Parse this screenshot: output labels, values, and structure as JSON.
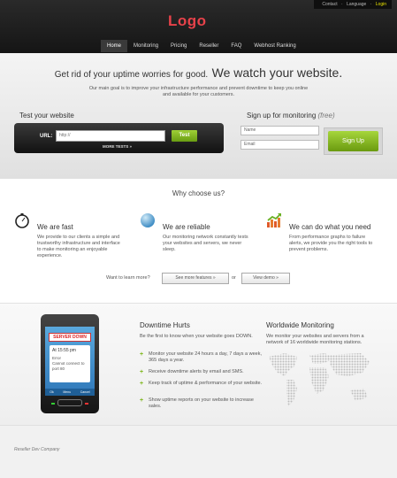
{
  "topbar": {
    "contact": "Contact",
    "sep1": "·",
    "language": "Language",
    "sep2": "·",
    "login": "Login"
  },
  "logo": "Logo",
  "nav": [
    "Home",
    "Monitoring",
    "Pricing",
    "Reseller",
    "FAQ",
    "Webhost Ranking"
  ],
  "hero": {
    "tagline_small": "Get rid of your uptime worries for good.",
    "tagline_big": "We watch your website.",
    "subtitle": "Our main goal is to improve your infrastructure performance and prevent downtime to keep you online and available for your customers."
  },
  "test": {
    "title": "Test your website",
    "url_label": "URL:",
    "url_value": "http://",
    "button": "Test",
    "more": "MORE TESTS »"
  },
  "signup": {
    "title": "Sign up for monitoring",
    "free": "(free)",
    "name_placeholder": "Name",
    "email_placeholder": "Email",
    "button": "Sign Up"
  },
  "why": {
    "title": "Why choose us?",
    "features": [
      {
        "title": "We are fast",
        "text": "We provide to our clients a simple and trustworthy infrastructure and interface to make monitoring an enjoyable experience."
      },
      {
        "title": "We are reliable",
        "text": "Our monitoring network constantly tests your websites and servers, we never sleep."
      },
      {
        "title": "We can do what you need",
        "text": "From performance graphs to failure alerts, we provide you the right tools to prevent problems."
      }
    ],
    "learn": "Want to learn more?",
    "features_btn": "See more features »",
    "or": "or",
    "demo_btn": "View demo »"
  },
  "phone": {
    "alert": "SERVER DOWN",
    "time": "At 15:55 pm",
    "error": "Error",
    "msg": "Cannot connect to port 80",
    "bar": [
      "Ok",
      "Menu",
      "Cancel"
    ]
  },
  "downtime": {
    "title": "Downtime Hurts",
    "intro": "Be the first to know when your website goes DOWN.",
    "bullets": [
      "Monitor your website 24 hours a day, 7 days a week, 365 days a year.",
      "Receive downtime alerts by email and SMS.",
      "Keep track of uptime & performance of your website.",
      "Show uptime reports on your website to increase sales."
    ]
  },
  "worldwide": {
    "title": "Worldwide Monitoring",
    "text": "We monitor your websites and servers from a network of 16 worldwide monitoring stations."
  },
  "footer": "Reseller Dev Company",
  "colors": {
    "accent_red": "#e8424a",
    "green": "#7cb518",
    "dark": "#151515"
  }
}
